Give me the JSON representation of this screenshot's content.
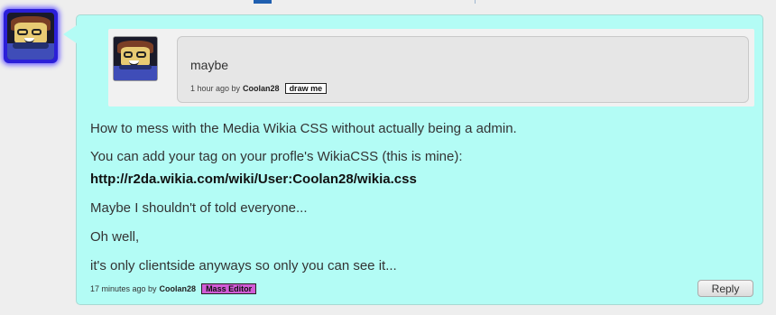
{
  "comment": {
    "author": "Coolan28",
    "quote": {
      "text": "maybe",
      "time": "1 hour ago by",
      "author": "Coolan28",
      "badge": "draw me"
    },
    "paragraphs": [
      "How to mess with the Media Wikia CSS without actually being a admin.",
      "You can add your tag on your profle's WikiaCSS (this is mine):",
      "http://r2da.wikia.com/wiki/User:Coolan28/wikia.css",
      "Maybe I shouldn't of told everyone...",
      "Oh well,",
      "it's only clientside anyways so only you can see it..."
    ],
    "footer": {
      "time": "17 minutes ago by",
      "author": "Coolan28",
      "badge": "Mass Editor"
    },
    "reply_label": "Reply"
  },
  "colors": {
    "bubble": "#b3fcf5",
    "avatar_glow": "#2b1fd8",
    "badge_mass_editor": "#d15bd6"
  }
}
